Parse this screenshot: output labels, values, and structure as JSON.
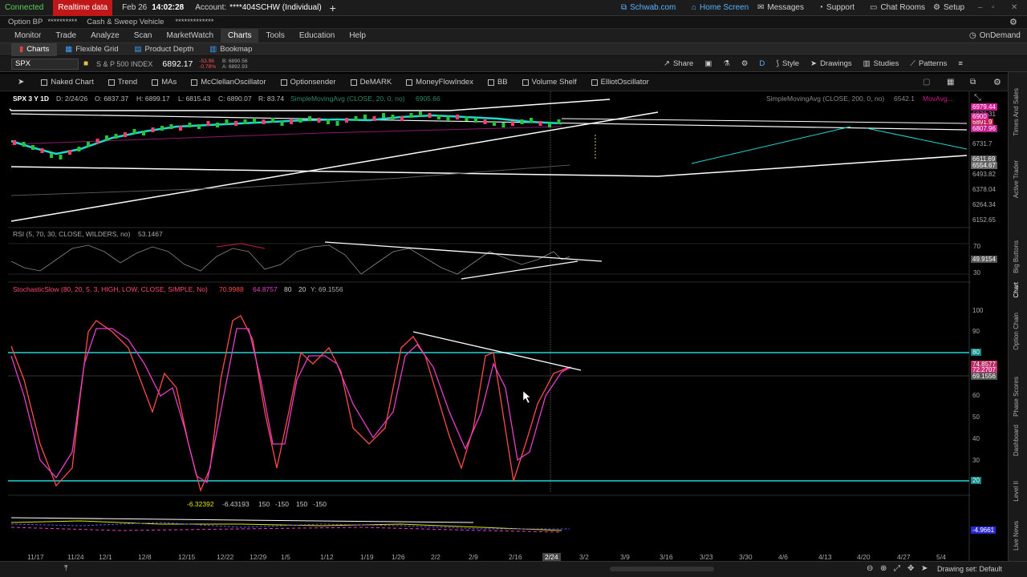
{
  "topbar": {
    "connected": "Connected",
    "realtime": "Realtime data",
    "date": "Feb 26",
    "time": "14:02:28",
    "account_label": "Account:",
    "account": "****404SCHW (Individual)",
    "schwab": "Schwab.com",
    "home": "Home Screen",
    "messages": "Messages",
    "support": "Support",
    "chat": "Chat Rooms",
    "setup": "Setup"
  },
  "row2": {
    "option_bp": "Option BP",
    "mask1": "**********",
    "cash_sweep": "Cash & Sweep Vehicle",
    "mask2": "*************"
  },
  "menu": [
    "Monitor",
    "Trade",
    "Analyze",
    "Scan",
    "MarketWatch",
    "Charts",
    "Tools",
    "Education",
    "Help"
  ],
  "menu_active": "Charts",
  "ondemand": "OnDemand",
  "subtabs": [
    "Charts",
    "Flexible Grid",
    "Product Depth",
    "Bookmap"
  ],
  "symbar": {
    "symbol": "SPX",
    "name": "S & P 500 INDEX",
    "price": "6892.17",
    "chg1": "-53.96",
    "chg2": "-0.78%",
    "bid": "B: 6890.56",
    "ask": "A: 6892.93",
    "share": "Share",
    "d": "D",
    "style": "Style",
    "drawings": "Drawings",
    "studies": "Studies",
    "patterns": "Patterns"
  },
  "studies_bar": [
    "Naked Chart",
    "Trend",
    "MAs",
    "McClellanOscillator",
    "Optionsender",
    "DeMARK",
    "MoneyFlowIndex",
    "BB",
    "Volume Shelf",
    "ElliotOscillator"
  ],
  "price_panel": {
    "header": "SPX 3 Y 1D",
    "date": "D: 2/24/26",
    "open": "O: 6837.37",
    "high": "H: 6899.17",
    "low": "L: 6815.43",
    "close": "C: 6890.07",
    "range": "R: 83.74",
    "sma1": "SimpleMovingAvg (CLOSE, 20, 0, no)",
    "sma1v": "6905.66",
    "sma2": "SimpleMovingAvg (CLOSE, 200, 0, no)",
    "sma2v": "6542.1",
    "movavg": "MovAvg...",
    "yticks": [
      "6978.31",
      "6731.7",
      "6493.82",
      "6378.04",
      "6264.34",
      "6152.65"
    ],
    "badges": [
      {
        "text": "6979.44",
        "color": "#d0198f"
      },
      {
        "text": "6891.9",
        "color": "#c0204a"
      },
      {
        "text": "6900",
        "color": "#d01a8f"
      },
      {
        "text": "6807.96",
        "color": "#c01b8f"
      },
      {
        "text": "6611.69",
        "color": "#555555"
      },
      {
        "text": "6554.67",
        "color": "#666666"
      }
    ]
  },
  "rsi_panel": {
    "title": "RSI (5, 70, 30, CLOSE, WILDERS, no)",
    "value": "53.1467",
    "yticks": [
      "70",
      "30"
    ],
    "badge": "49.9154"
  },
  "stoch_panel": {
    "title": "StochasticSlow (80, 20, 5, 3, HIGH, LOW, CLOSE, SIMPLE, No)",
    "k": "70.9988",
    "d": "64.8757",
    "ob": "80",
    "os": "20",
    "y": "Y: 69.1556",
    "yticks": [
      "100",
      "90",
      "70",
      "60",
      "50",
      "40",
      "30"
    ],
    "badges": [
      {
        "text": "80",
        "color": "#0c8a87"
      },
      {
        "text": "74.8577",
        "color": "#b5295a"
      },
      {
        "text": "72.2707",
        "color": "#c9307a"
      },
      {
        "text": "69.1556",
        "color": "#555555"
      },
      {
        "text": "20",
        "color": "#0c8a87"
      }
    ]
  },
  "bottom_panel": {
    "v1": "-6.32392",
    "v2": "-6.43193",
    "v3": "150",
    "v4": "-150",
    "v5": "150",
    "v6": "-150",
    "badge": "-4.9661"
  },
  "xaxis": [
    "11/17",
    "11/24",
    "12/1",
    "12/8",
    "12/15",
    "12/22",
    "12/29",
    "1/5",
    "1/12",
    "1/19",
    "1/26",
    "2/2",
    "2/9",
    "2/16",
    "2/24",
    "3/2",
    "3/9",
    "3/16",
    "3/23",
    "3/30",
    "4/6",
    "4/13",
    "4/20",
    "4/27",
    "5/4"
  ],
  "right_tabs": [
    "Times And Sales",
    "Active Trader",
    "Big Buttons",
    "Chart",
    "Option Chain",
    "Phase Scores",
    "Dashboard",
    "Level II",
    "Live News"
  ],
  "status": {
    "drawing_set": "Drawing set: Default"
  },
  "colors": {
    "cyan": "#1fd8cf",
    "magenta": "#e83ec8",
    "salmon": "#ff5a5a",
    "green": "#25c43a",
    "red": "#ff3b5c",
    "white": "#ffffff"
  }
}
